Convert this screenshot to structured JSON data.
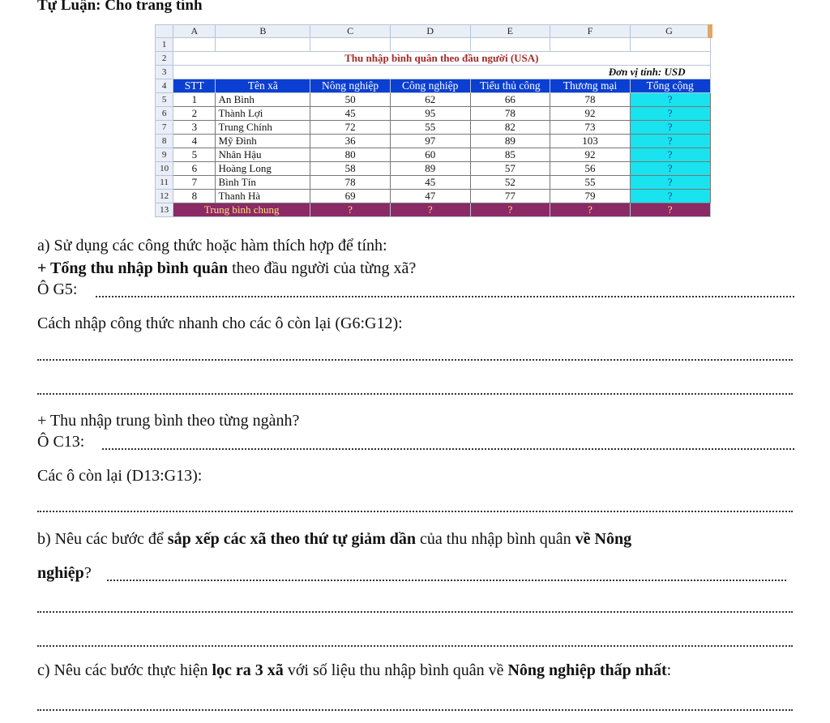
{
  "title": "Tự Luận: Cho trang tính",
  "sheet": {
    "col_headers": [
      "A",
      "B",
      "C",
      "D",
      "E",
      "F",
      "G"
    ],
    "row_numbers": [
      "1",
      "2",
      "3",
      "4",
      "5",
      "6",
      "7",
      "8",
      "9",
      "10",
      "11",
      "12",
      "13"
    ],
    "table_title": "Thu nhập bình quân theo đầu người  (USA)",
    "unit": "Đơn vị tính: USD",
    "headers": [
      "STT",
      "Tên xã",
      "Nông nghiệp",
      "Công nghiệp",
      "Tiểu thủ công",
      "Thương mại",
      "Tổng cộng"
    ],
    "rows": [
      [
        "1",
        "An Bình",
        "50",
        "62",
        "66",
        "78",
        "?"
      ],
      [
        "2",
        "Thành Lợi",
        "45",
        "95",
        "78",
        "92",
        "?"
      ],
      [
        "3",
        "Trung Chính",
        "72",
        "55",
        "82",
        "73",
        "?"
      ],
      [
        "4",
        "Mỹ Đình",
        "36",
        "97",
        "89",
        "103",
        "?"
      ],
      [
        "5",
        "Nhân Hậu",
        "80",
        "60",
        "85",
        "92",
        "?"
      ],
      [
        "6",
        "Hoàng Long",
        "58",
        "89",
        "57",
        "56",
        "?"
      ],
      [
        "7",
        "Bình Tín",
        "78",
        "45",
        "52",
        "55",
        "?"
      ],
      [
        "8",
        "Thanh Hà",
        "69",
        "47",
        "77",
        "79",
        "?"
      ]
    ],
    "avg_label": "Trung bình chung",
    "avg_values": [
      "?",
      "?",
      "?",
      "?",
      "?"
    ]
  },
  "text": {
    "a_intro": "a) Sử dụng các công thức hoặc hàm thích hợp để tính:",
    "a1_bold": "+ Tổng thu nhập bình quân",
    "a1_rest": " theo đầu người của từng xã?",
    "g5": "Ô G5:",
    "fill_prompt": "Cách nhập công thức nhanh cho các ô còn lại (G6:G12):",
    "a2": "+ Thu nhập trung bình theo từng ngành?",
    "c13": "Ô C13:",
    "rest_prompt": "Các ô còn lại (D13:G13):",
    "b_start": "b) Nêu các bước để ",
    "b_bold": "sắp xếp các xã theo thứ tự giảm dần",
    "b_mid": " của thu nhập bình quân ",
    "b_bold2": "về Nông",
    "b_line2_bold": "nghiệp",
    "b_line2_rest": "?",
    "c_start": "c) Nêu các bước thực hiện ",
    "c_bold": "lọc ra 3 xã",
    "c_mid": " với số liệu thu nhập bình quân về ",
    "c_bold2": "Nông nghiệp thấp nhất",
    "c_end": ":"
  }
}
